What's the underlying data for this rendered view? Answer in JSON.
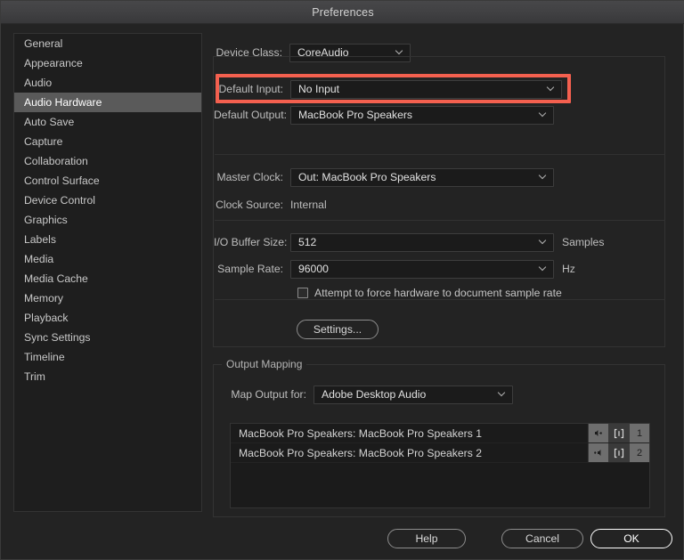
{
  "window": {
    "title": "Preferences"
  },
  "sidebar": {
    "items": [
      {
        "label": "General",
        "selected": false
      },
      {
        "label": "Appearance",
        "selected": false
      },
      {
        "label": "Audio",
        "selected": false
      },
      {
        "label": "Audio Hardware",
        "selected": true
      },
      {
        "label": "Auto Save",
        "selected": false
      },
      {
        "label": "Capture",
        "selected": false
      },
      {
        "label": "Collaboration",
        "selected": false
      },
      {
        "label": "Control Surface",
        "selected": false
      },
      {
        "label": "Device Control",
        "selected": false
      },
      {
        "label": "Graphics",
        "selected": false
      },
      {
        "label": "Labels",
        "selected": false
      },
      {
        "label": "Media",
        "selected": false
      },
      {
        "label": "Media Cache",
        "selected": false
      },
      {
        "label": "Memory",
        "selected": false
      },
      {
        "label": "Playback",
        "selected": false
      },
      {
        "label": "Sync Settings",
        "selected": false
      },
      {
        "label": "Timeline",
        "selected": false
      },
      {
        "label": "Trim",
        "selected": false
      }
    ]
  },
  "device_panel": {
    "device_class": {
      "label": "Device Class:",
      "value": "CoreAudio"
    },
    "default_input": {
      "label": "Default Input:",
      "value": "No Input"
    },
    "default_output": {
      "label": "Default Output:",
      "value": "MacBook Pro Speakers"
    },
    "master_clock": {
      "label": "Master Clock:",
      "value": "Out: MacBook Pro Speakers"
    },
    "clock_source": {
      "label": "Clock Source:",
      "value": "Internal"
    },
    "io_buffer_size": {
      "label": "I/O Buffer Size:",
      "value": "512",
      "unit": "Samples"
    },
    "sample_rate": {
      "label": "Sample Rate:",
      "value": "96000",
      "unit": "Hz"
    },
    "force_sample_rate": {
      "label": "Attempt to force hardware to document sample rate",
      "checked": false
    },
    "settings_button": "Settings..."
  },
  "output_mapping": {
    "legend": "Output Mapping",
    "map_output_for": {
      "label": "Map Output for:",
      "value": "Adobe Desktop Audio"
    },
    "rows": [
      {
        "name": "MacBook Pro Speakers: MacBook Pro Speakers 1",
        "pan_icon": "speaker-right-icon",
        "clip_icon": "channel-bracket-icon",
        "channel": "1"
      },
      {
        "name": "MacBook Pro Speakers: MacBook Pro Speakers 2",
        "pan_icon": "speaker-left-icon",
        "clip_icon": "channel-bracket-icon",
        "channel": "2"
      }
    ]
  },
  "footer": {
    "help": "Help",
    "cancel": "Cancel",
    "ok": "OK"
  },
  "annotation": {
    "highlight_color": "#f4604f",
    "target": "default-input-row"
  }
}
